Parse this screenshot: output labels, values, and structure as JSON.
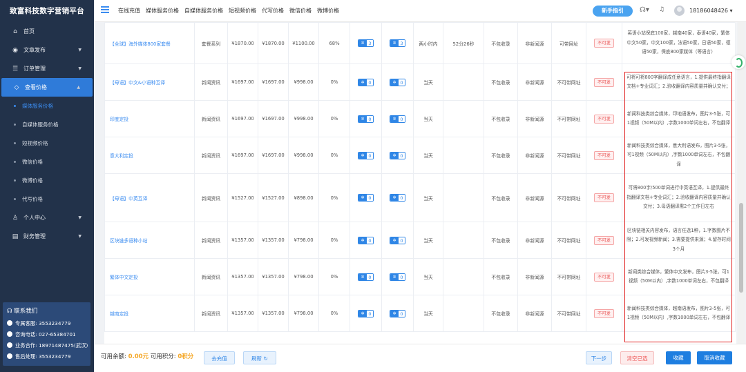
{
  "app": {
    "title": "致富科技数字营销平台"
  },
  "sidebar": {
    "menu": [
      {
        "label": "首页",
        "icon": "home-icon",
        "glyph": "⌂",
        "arrow": false
      },
      {
        "label": "文章发布",
        "icon": "compass-icon",
        "glyph": "◉",
        "arrow": true
      },
      {
        "label": "订单管理",
        "icon": "list-icon",
        "glyph": "☰",
        "arrow": true
      },
      {
        "label": "查看价格",
        "icon": "tag-icon",
        "glyph": "◇",
        "arrow": true,
        "active": true
      }
    ],
    "submenu": [
      {
        "label": "媒体服务价格",
        "current": true
      },
      {
        "label": "自媒体服务价格"
      },
      {
        "label": "短视频价格"
      },
      {
        "label": "微信价格"
      },
      {
        "label": "微博价格"
      },
      {
        "label": "代写价格"
      }
    ],
    "menu2": [
      {
        "label": "个人中心",
        "icon": "user-icon",
        "glyph": "♙",
        "arrow": true
      },
      {
        "label": "财务管理",
        "icon": "wallet-icon",
        "glyph": "▤",
        "arrow": true
      }
    ],
    "contact": {
      "title": "联系我们",
      "rows": [
        "专属客服: 3553234779",
        "咨询电话: 027-65384701",
        "业务合作: 18971487475(武汉)",
        "售后处理: 3553234779"
      ]
    }
  },
  "topbar": {
    "nav": [
      "在线充值",
      "媒体服务价格",
      "自媒体服务价格",
      "短视频价格",
      "代写价格",
      "微信价格",
      "微博价格"
    ],
    "guide": "新手指引",
    "phone": "18186048426 ▾"
  },
  "table": {
    "rows": [
      {
        "name": "【全球】海外媒体800家套餐",
        "type": "套餐系列",
        "p1": "¥1870.00",
        "p2": "¥1870.00",
        "p3": "¥1100.00",
        "pct": "68%",
        "b1": "3",
        "b2": "3",
        "time": "两小时内",
        "dur": "52分26秒",
        "inc": "不包收录",
        "src": "非新闻源",
        "link": "可带网址",
        "tag": "不可发",
        "desc": "英语小站保底100家，越南40家，泰语40家，繁体中文50家，中文100家，法语50家，日语50家，德语50家，保底800家媒体（等语言）"
      },
      {
        "name": "【母语】中文&小语种互译",
        "type": "新闻资讯",
        "p1": "¥1697.00",
        "p2": "¥1697.00",
        "p3": "¥998.00",
        "pct": "0%",
        "b1": "0",
        "b2": "0",
        "time": "当天",
        "dur": "",
        "inc": "不包收录",
        "src": "非新闻源",
        "link": "不可带网址",
        "tag": "不可发",
        "desc": "可将可将800字翻译成任意语言，1.提供最终指翻译文档+专业词汇；2.验收翻译内容质量并确认交付；"
      },
      {
        "name": "印度定投",
        "type": "新闻资讯",
        "p1": "¥1697.00",
        "p2": "¥1697.00",
        "p3": "¥998.00",
        "pct": "0%",
        "b1": "0",
        "b2": "0",
        "time": "当天",
        "dur": "",
        "inc": "不包收录",
        "src": "非新闻源",
        "link": "不可带网址",
        "tag": "不可发",
        "desc": "新闻科技类综合媒体，印地语发布，图片3-5张，可1视频（50M以内）,字数1000单词左右，不包翻译"
      },
      {
        "name": "意大利定投",
        "type": "新闻资讯",
        "p1": "¥1697.00",
        "p2": "¥1697.00",
        "p3": "¥998.00",
        "pct": "0%",
        "b1": "0",
        "b2": "0",
        "time": "当天",
        "dur": "",
        "inc": "不包收录",
        "src": "非新闻源",
        "link": "不可带网址",
        "tag": "不可发",
        "desc": "新闻科技类综合媒体，意大利语发布，图片3-5张，可1视频（50M以内）,字数1000单词左右，不包翻译"
      },
      {
        "name": "【母语】中英互译",
        "type": "新闻资讯",
        "p1": "¥1527.00",
        "p2": "¥1527.00",
        "p3": "¥898.00",
        "pct": "0%",
        "b1": "0",
        "b2": "0",
        "time": "当天",
        "dur": "",
        "inc": "不包收录",
        "src": "非新闻源",
        "link": "不可带网址",
        "tag": "不可发",
        "desc": "可将800字/500单词进行中英语互译，1.提供最终指翻译文档+专业词汇；2.验收翻译内容质量并确认交付；3.母语翻译需2个工作日左右"
      },
      {
        "name": "区块链多语种小站",
        "type": "新闻资讯",
        "p1": "¥1357.00",
        "p2": "¥1357.00",
        "p3": "¥798.00",
        "pct": "0%",
        "b1": "0",
        "b2": "0",
        "time": "当天",
        "dur": "",
        "inc": "不包收录",
        "src": "非新闻源",
        "link": "不可带网址",
        "tag": "不可发",
        "desc": "区块链相关内容发布，语言任选1种，1.字数图片不限；2.可发视频新闻；3.需要提供来源；4.留存时间3个月"
      },
      {
        "name": "繁体中文定投",
        "type": "新闻资讯",
        "p1": "¥1357.00",
        "p2": "¥1357.00",
        "p3": "¥798.00",
        "pct": "0%",
        "b1": "0",
        "b2": "0",
        "time": "当天",
        "dur": "",
        "inc": "不包收录",
        "src": "非新闻源",
        "link": "不可带网址",
        "tag": "不可发",
        "desc": "新闻类综合媒体，繁体中文发布，图片3-5张，可1视频（50M以内）,字数1000单词左右，不包翻译"
      },
      {
        "name": "越南定投",
        "type": "新闻资讯",
        "p1": "¥1357.00",
        "p2": "¥1357.00",
        "p3": "¥798.00",
        "pct": "0%",
        "b1": "0",
        "b2": "0",
        "time": "当天",
        "dur": "",
        "inc": "不包收录",
        "src": "非新闻源",
        "link": "不可带网址",
        "tag": "不可发",
        "desc": "新闻科技类综合媒体，越南语发布，图片3-5张，可1视频（50M以内）,字数1000单词左右，不包翻译"
      }
    ]
  },
  "footer": {
    "balance_label": "可用余额:",
    "balance": "0.00元",
    "points_label": "可用积分:",
    "points": "0积分",
    "recharge": "去充值",
    "refresh": "刷新",
    "next": "下一步",
    "clear": "清空已选",
    "collect": "收藏",
    "uncollect": "取消收藏"
  },
  "colors": {
    "accent": "#2f86e6",
    "sidebar": "#22324a",
    "highlight": "#e02020"
  }
}
